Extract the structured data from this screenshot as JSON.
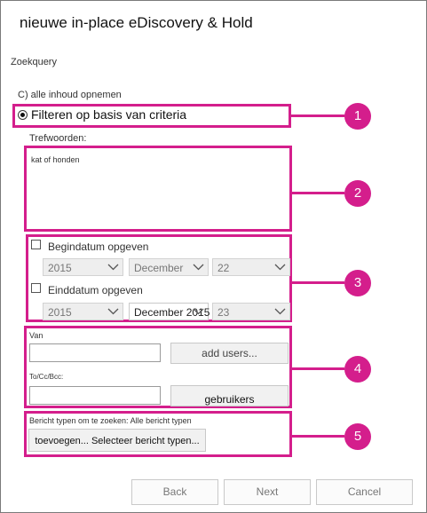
{
  "window": {
    "title": "nieuwe in-place eDiscovery & Hold"
  },
  "search_query": {
    "section_label": "Zoekquery",
    "option_all": "C) alle inhoud opnemen",
    "option_filter": "Filteren op basis van criteria",
    "keywords_label": "Trefwoorden:",
    "keywords_value": "kat of honden"
  },
  "dates": {
    "start_label": "Begindatum opgeven",
    "start": {
      "year": "2015",
      "month": "December",
      "day": "22"
    },
    "end_label": "Einddatum opgeven",
    "end": {
      "year": "2015",
      "month": "December 2015",
      "day": "23"
    }
  },
  "people": {
    "from_label": "Van",
    "add_users_button": "add users...",
    "to_label": "To/Cc/Bcc:",
    "users_button": "gebruikers"
  },
  "message_types": {
    "label": "Bericht typen om te zoeken:  Alle bericht typen",
    "add_button": "toevoegen... Selecteer bericht typen..."
  },
  "callouts": [
    "1",
    "2",
    "3",
    "4",
    "5"
  ],
  "footer": {
    "back": "Back",
    "next": "Next",
    "cancel": "Cancel"
  },
  "colors": {
    "callout": "#d41e8c"
  }
}
